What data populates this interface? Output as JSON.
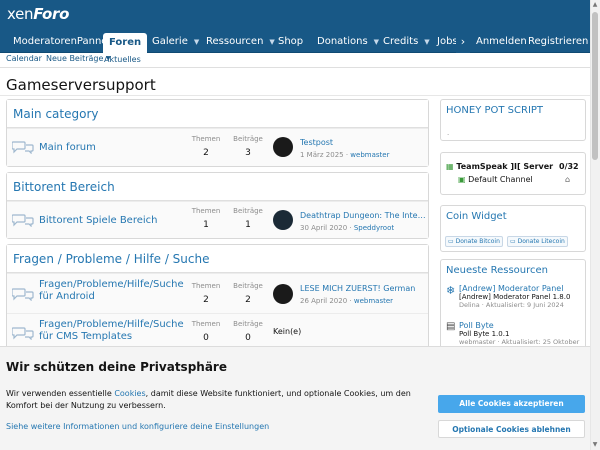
{
  "logo": {
    "text_plain": "xen",
    "text_italic": "Foro"
  },
  "nav": {
    "tabs": [
      {
        "label": "ModeratorenPannel"
      },
      {
        "label": "Foren"
      },
      {
        "label": "Galerie"
      },
      {
        "label": "Ressourcen"
      },
      {
        "label": "Shop"
      },
      {
        "label": "Donations"
      },
      {
        "label": "Credits"
      },
      {
        "label": "Jobs"
      }
    ],
    "scroll_right": "›",
    "login": "Anmelden",
    "register": "Registrieren",
    "sub": [
      "Calendar",
      "Neue Beiträge",
      "Aktuelles"
    ]
  },
  "page_title": "Gameserversupport",
  "categories": [
    {
      "title": "Main category",
      "forums": [
        {
          "title": "Main forum",
          "threads_label": "Themen",
          "threads": "2",
          "posts_label": "Beiträge",
          "posts": "3",
          "latest_title": "Testpost",
          "latest_date": "1 März 2025",
          "latest_user": "webmaster"
        }
      ]
    },
    {
      "title": "Bittorent Bereich",
      "forums": [
        {
          "title": "Bittorent Spiele Bereich",
          "threads_label": "Themen",
          "threads": "1",
          "posts_label": "Beiträge",
          "posts": "1",
          "latest_title": "Deathtrap Dungeon: The Interactive Video",
          "latest_date": "30 April 2020",
          "latest_user": "Speddyroot"
        }
      ]
    },
    {
      "title": "Fragen / Probleme / Hilfe / Suche",
      "forums": [
        {
          "title_line1": "Fragen/Probleme/Hilfe/Suche",
          "title_line2": "für Android",
          "threads_label": "Themen",
          "threads": "2",
          "posts_label": "Beiträge",
          "posts": "2",
          "latest_title": "LESE MICH ZUERST! German",
          "latest_date": "26 April 2020",
          "latest_user": "webmaster"
        },
        {
          "title_line1": "Fragen/Probleme/Hilfe/Suche",
          "title_line2": "für CMS Templates",
          "threads_label": "Themen",
          "threads": "0",
          "posts_label": "Beiträge",
          "posts": "0",
          "latest_none": "Kein(e)"
        }
      ]
    }
  ],
  "sidebar": {
    "honeypot": {
      "title": "HONEY POT SCRIPT"
    },
    "teamspeak": {
      "server": "TeamSpeak ]I[ Server",
      "count": "0/32",
      "channel": "Default Channel"
    },
    "coin": {
      "title": "Coin Widget",
      "btc": "Donate Bitcoin",
      "ltc": "Donate Litecoin"
    },
    "resources": {
      "title": "Neueste Ressourcen",
      "items": [
        {
          "title": "[Andrew] Moderator Panel",
          "sub": "[Andrew] Moderator Panel 1.8.0",
          "meta": "Delina · Aktualisiert: 9 Juni 2024"
        },
        {
          "title": "Poll Byte",
          "sub": "Poll Byte 1.0.1",
          "meta": "webmaster · Aktualisiert: 25 Oktober"
        }
      ]
    }
  },
  "cookie": {
    "heading": "Wir schützen deine Privatsphäre",
    "text_before": "Wir verwenden essentielle ",
    "link": "Cookies",
    "text_after": ", damit diese Website funktioniert, und optionale Cookies, um den Komfort bei der Nutzung zu verbessern.",
    "more": "Siehe weitere Informationen und konfiguriere deine Einstellungen",
    "accept": "Alle Cookies akzeptieren",
    "reject": "Optionale Cookies ablehnen"
  },
  "colors": {
    "header": "#185886",
    "link": "#2577b1",
    "accept": "#47a7eb"
  }
}
